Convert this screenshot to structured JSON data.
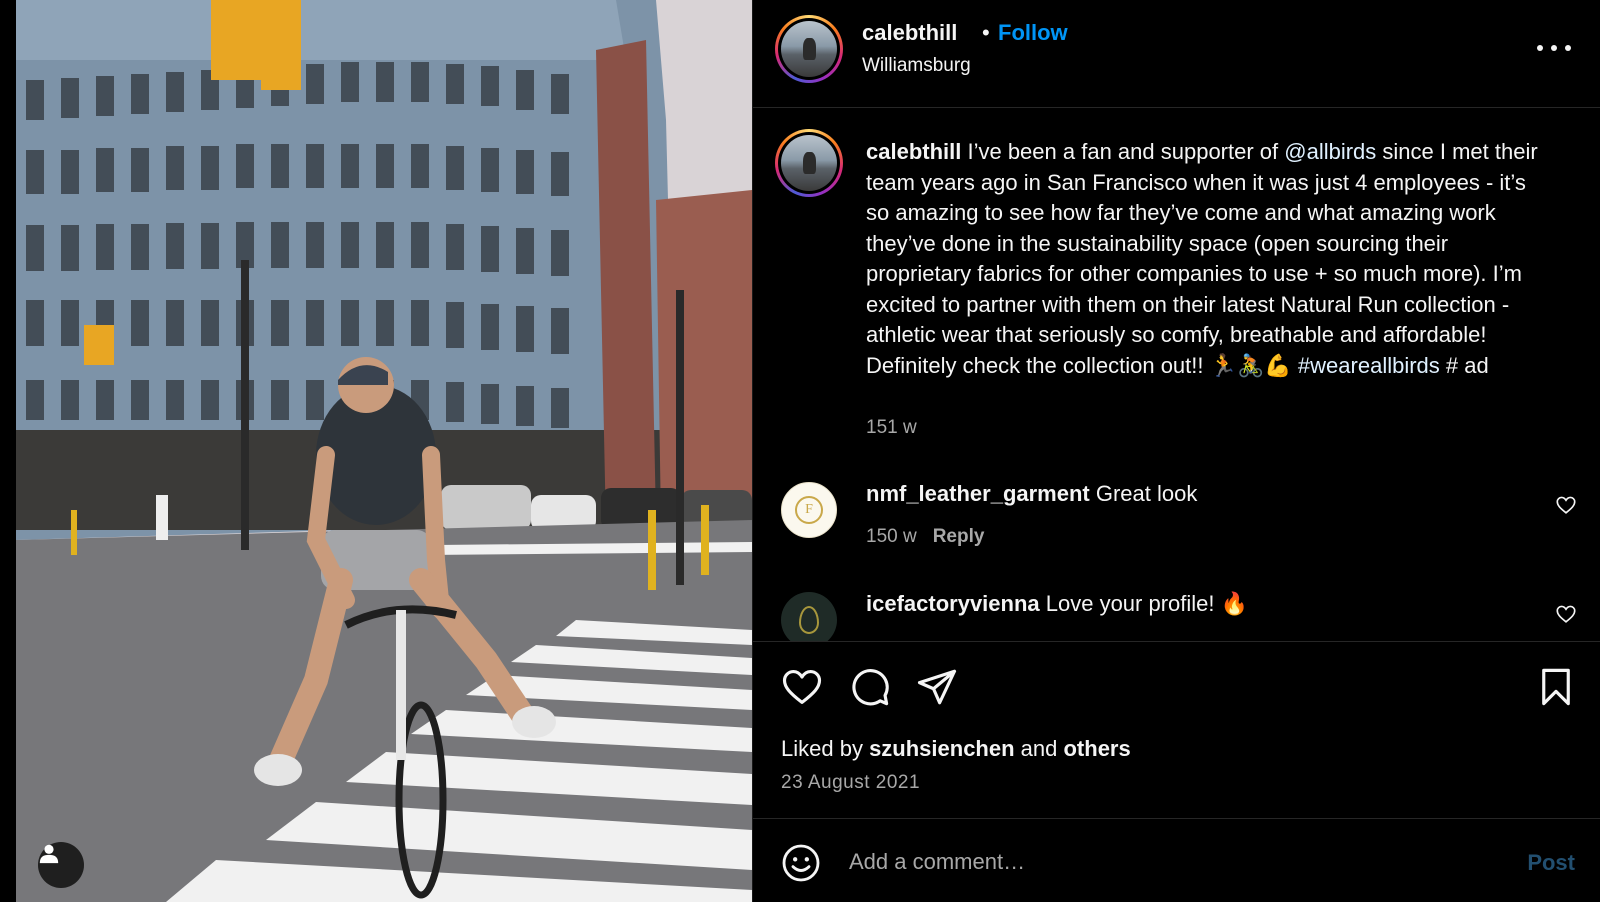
{
  "post": {
    "username": "calebthill",
    "separator": "•",
    "follow_label": "Follow",
    "location": "Williamsburg",
    "more_icon": "more-horizontal-icon"
  },
  "caption": {
    "username": "calebthill",
    "text_before_mention": " I’ve been a fan and supporter of ",
    "mention": "@allbirds",
    "text_after_mention": " since I met their team years ago in San Francisco when it was just 4 employees - it’s so amazing to see how far they’ve come and what amazing work they’ve done in the sustainability space (open sourcing their proprietary fabrics for other companies to use + so much more). I’m excited to partner with them on their latest Natural Run collection - athletic wear that seriously so comfy, breathable and affordable! Definitely check the collection out!! 🏃🚴💪 ",
    "hashtag": "#weareallbirds",
    "text_end": " # ad",
    "time": "151 w"
  },
  "comments": [
    {
      "username": "nmf_leather_garment",
      "text": " Great look",
      "time": "150 w",
      "reply_label": "Reply",
      "avatar_letter": "F"
    },
    {
      "username": "icefactoryvienna",
      "text": " Love your profile! 🔥"
    }
  ],
  "actions": {
    "liked_by_prefix": "Liked by ",
    "liked_by_user": "szuhsienchen",
    "liked_by_middle": " and ",
    "liked_by_others": "others",
    "date": "23 August 2021"
  },
  "add_comment": {
    "placeholder": "Add a comment…",
    "post_label": "Post"
  },
  "colors": {
    "accent": "#0095f6",
    "mention": "#e0f1ff",
    "muted": "#a8a8a8",
    "post_disabled": "#224f70"
  }
}
